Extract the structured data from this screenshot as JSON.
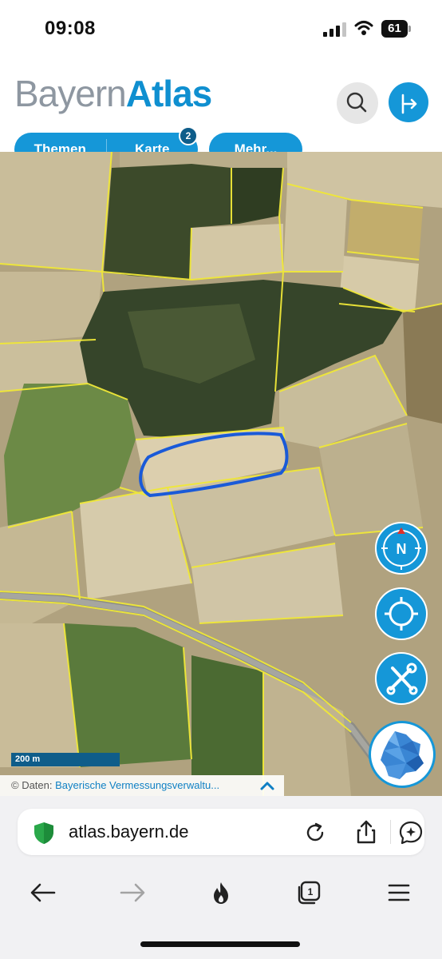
{
  "status_bar": {
    "time": "09:08",
    "battery_level": "61",
    "signal_bars": 3,
    "icons": [
      "cellular-signal-icon",
      "wifi-icon",
      "battery-icon"
    ]
  },
  "header": {
    "logo_part1": "Bayern",
    "logo_part2": "Atlas",
    "logo_color_primary": "#8e97a1",
    "logo_color_accent": "#0f8fd0",
    "search_button_icon": "search-icon",
    "route_button_icon": "route-arrow-icon",
    "tabs": {
      "themen": "Themen",
      "karte": "Karte",
      "karte_badge": "2",
      "mehr": "Mehr..."
    },
    "accent_color": "#1597d8"
  },
  "map": {
    "scale_label": "200 m",
    "attribution_prefix": "© Daten:",
    "attribution_link": "Bayerische Vermessungsverwaltu...",
    "compass_label": "N",
    "controls": [
      "compass-icon",
      "locate-crosshair-icon",
      "tools-wrench-screwdriver-icon",
      "bavaria-map-icon"
    ],
    "parcel_line_color": "#f0e838",
    "highlight_color": "#1a5ad8"
  },
  "browser": {
    "url": "atlas.bayern.de",
    "tab_count": "1",
    "toolbar_icons": [
      "back-arrow-icon",
      "forward-arrow-icon",
      "fire-icon",
      "tabs-icon",
      "menu-icon"
    ]
  }
}
